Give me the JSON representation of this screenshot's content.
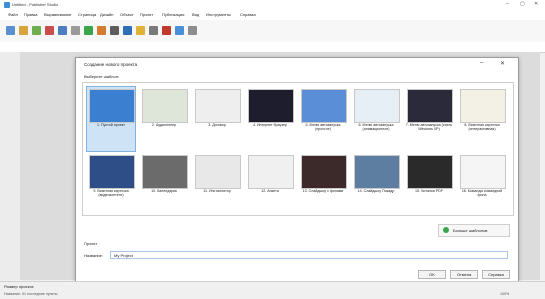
{
  "window": {
    "title": "Untitled - Publisher Studio",
    "min": "–",
    "max": "▢",
    "close": "✕"
  },
  "menu": [
    "Файл",
    "Правка",
    "Выравнивание",
    "Страница",
    "Дизайн",
    "Объект",
    "Проект",
    "Публикация",
    "Вид",
    "Инструменты",
    "Справка"
  ],
  "toolbar_colors": [
    "#5a8fd0",
    "#d9a53a",
    "#6fae4f",
    "#c94d4d",
    "#4e7ec2",
    "#9a9a9a",
    "#3ba54a",
    "#d47c2f",
    "#5d5d5d",
    "#2f6fb8",
    "#e0b23a",
    "#7a7a7a",
    "#c0392b",
    "#4a90d9",
    "#8e8e8e"
  ],
  "dialog": {
    "title": "Создание нового проекта",
    "pick_label": "Выберите шаблон:",
    "min": "–",
    "close": "✕",
    "templates": [
      {
        "label": "1. Пустой проект",
        "color": "#3b7fd0",
        "selected": true
      },
      {
        "label": "2. Аудиоплеер",
        "color": "#dde6d8",
        "selected": false
      },
      {
        "label": "3. Договор",
        "color": "#eeeeee",
        "selected": false
      },
      {
        "label": "4. Интернет браузер",
        "color": "#1d1d2e",
        "selected": false
      },
      {
        "label": "5. Меню автозапуска (простое)",
        "color": "#5a8fd8",
        "selected": false
      },
      {
        "label": "6. Меню автозапуска (анимационное)",
        "color": "#e6eef6",
        "selected": false
      },
      {
        "label": "7. Меню автозапуска (стиль Windows XP)",
        "color": "#2a2a3a",
        "selected": false
      },
      {
        "label": "8. Визитная карточка (интерактивная)",
        "color": "#f3f1e6",
        "selected": false
      },
      {
        "label": "9. Визитная карточка (видеоконтент)",
        "color": "#2d4e86",
        "selected": false
      },
      {
        "label": "10. Календарик",
        "color": "#6b6b6b",
        "selected": false
      },
      {
        "label": "11. Инсталлятор",
        "color": "#e8e8e8",
        "selected": false
      },
      {
        "label": "12. Анкета",
        "color": "#f0f0f0",
        "selected": false
      },
      {
        "label": "13. Слайдшоу с фонами",
        "color": "#3c2a2a",
        "selected": false
      },
      {
        "label": "14. Слайдшоу Покадр",
        "color": "#5d7ea0",
        "selected": false
      },
      {
        "label": "15. Читалка PDF",
        "color": "#2a2a2a",
        "selected": false
      },
      {
        "label": "16. Команды командной фона",
        "color": "#f5f5f5",
        "selected": false
      }
    ],
    "more_label": "Больше шаблонов",
    "project_section": "Проект",
    "name_label": "Название:",
    "name_value": "My Project",
    "ok": "OK",
    "cancel": "Отмена",
    "help": "Справка"
  },
  "status": {
    "text": "Размер проекта",
    "sub": "Название: 01 последние пункты",
    "zoom": "100%"
  }
}
